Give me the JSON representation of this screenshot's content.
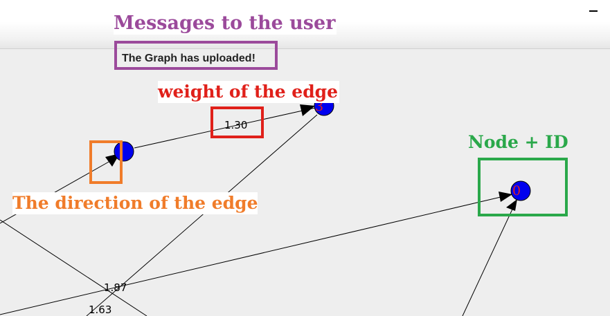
{
  "window": {
    "minimize_label": "_"
  },
  "status": {
    "message": "The Graph has uploaded!"
  },
  "callouts": {
    "messages": "Messages to the user",
    "weight": "weight of the edge",
    "node": "Node + ID",
    "direction": "The direction of the edge"
  },
  "graph": {
    "nodes": [
      {
        "id": "0",
        "label": "0"
      },
      {
        "id": "3",
        "label": "3"
      },
      {
        "id": "1",
        "label": ""
      }
    ],
    "edge_weights": [
      "1.30",
      "1.87",
      "1.63"
    ]
  },
  "colors": {
    "node_fill": "#0000ee",
    "node_id_text": "#e02020",
    "callout_messages": "#9b4a9b",
    "callout_weight": "#e0201a",
    "callout_node": "#2aa84a",
    "callout_direction": "#f07c2a"
  },
  "icons": [
    "minimize-icon",
    "arrowhead-icon"
  ]
}
